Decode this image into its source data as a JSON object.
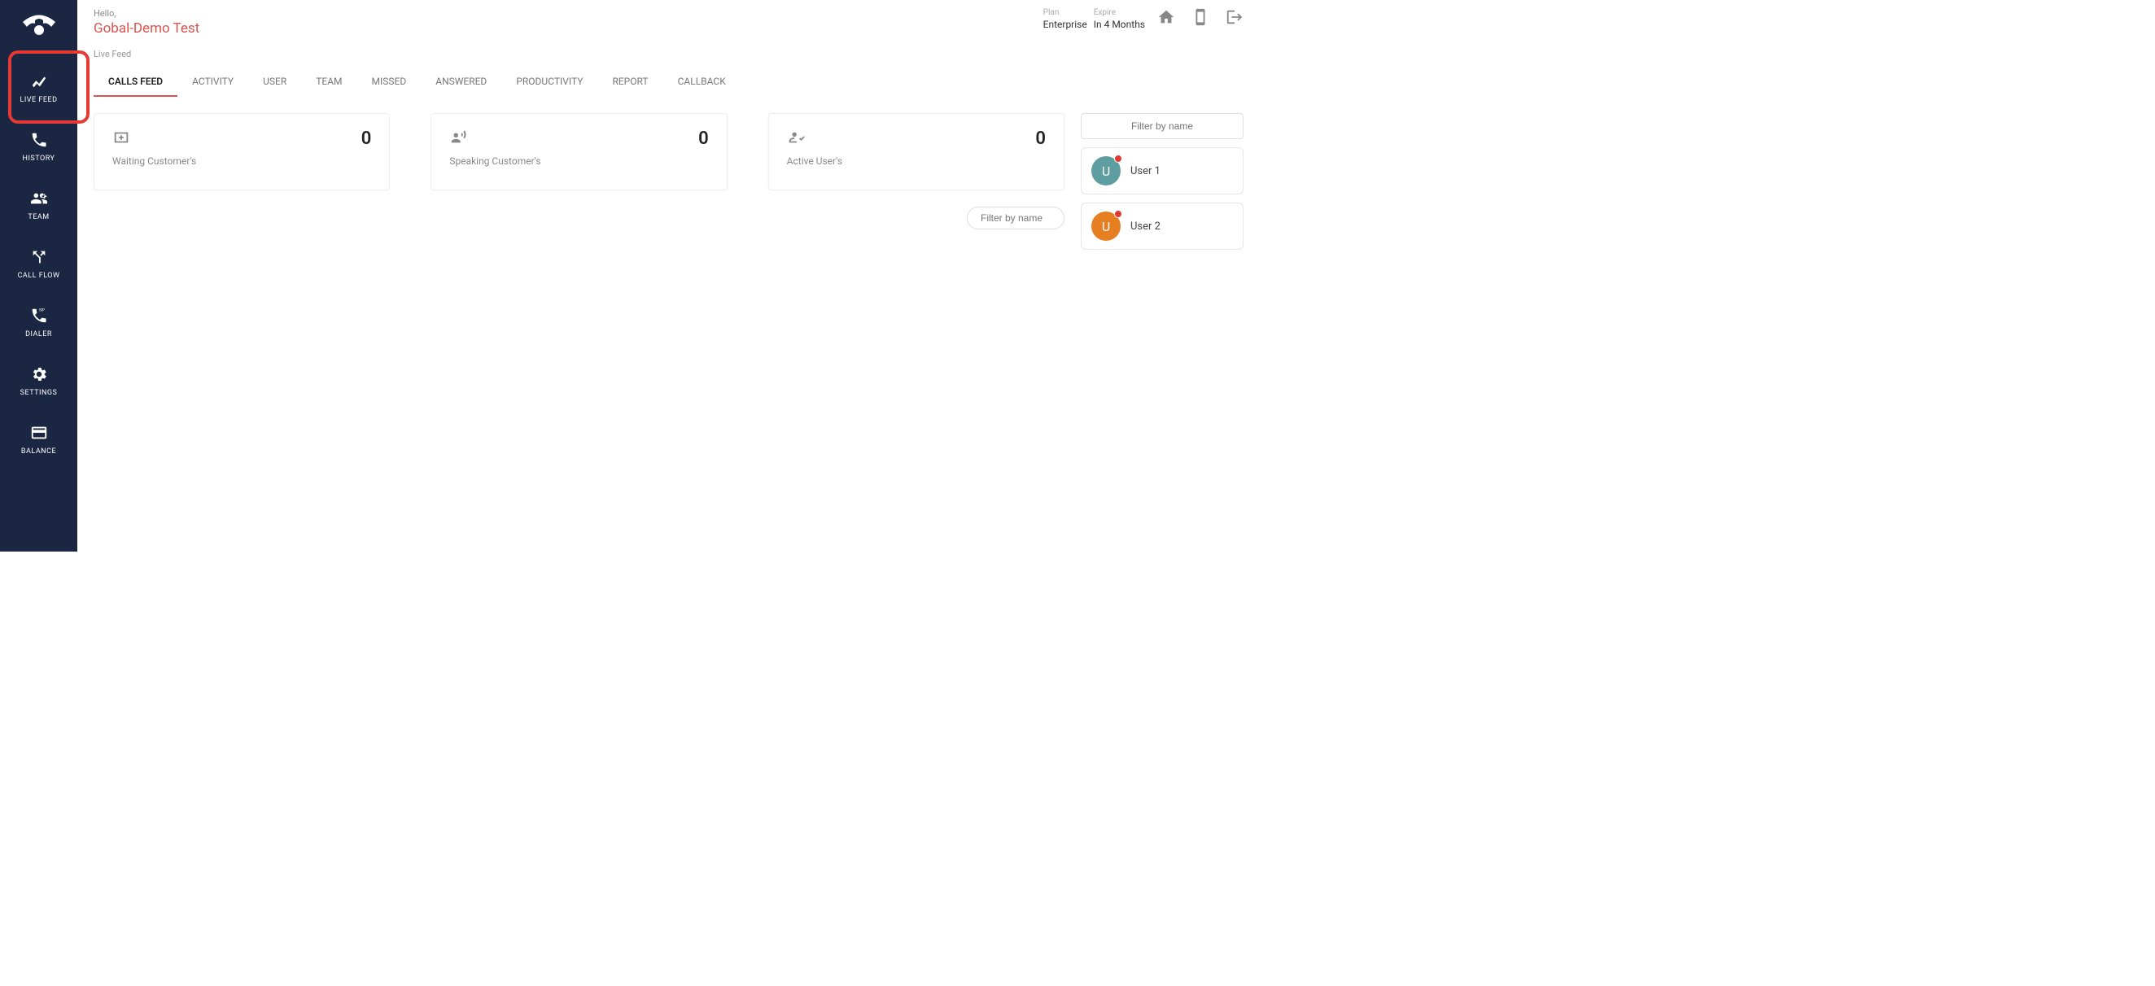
{
  "header": {
    "hello": "Hello,",
    "name": "Gobal-Demo Test",
    "plan_label": "Plan",
    "plan_value": "Enterprise",
    "expire_label": "Expire",
    "expire_value": "In 4 Months"
  },
  "breadcrumb": "Live Feed",
  "sidebar": {
    "items": [
      {
        "label": "LIVE FEED"
      },
      {
        "label": "HISTORY"
      },
      {
        "label": "TEAM"
      },
      {
        "label": "CALL FLOW"
      },
      {
        "label": "DIALER"
      },
      {
        "label": "SETTINGS"
      },
      {
        "label": "BALANCE"
      }
    ]
  },
  "tabs": [
    {
      "label": "CALLS FEED"
    },
    {
      "label": "ACTIVITY"
    },
    {
      "label": "USER"
    },
    {
      "label": "TEAM"
    },
    {
      "label": "MISSED"
    },
    {
      "label": "ANSWERED"
    },
    {
      "label": "PRODUCTIVITY"
    },
    {
      "label": "REPORT"
    },
    {
      "label": "CALLBACK"
    }
  ],
  "cards": [
    {
      "label": "Waiting Customer's",
      "value": "0"
    },
    {
      "label": "Speaking Customer's",
      "value": "0"
    },
    {
      "label": "Active User's",
      "value": "0"
    }
  ],
  "filter_pill_placeholder": "Filter by name",
  "user_filter_placeholder": "Filter by name",
  "users": [
    {
      "initial": "U",
      "name": "User 1",
      "color": "#5f9ea0"
    },
    {
      "initial": "U",
      "name": "User  2",
      "color": "#e67e22"
    }
  ]
}
